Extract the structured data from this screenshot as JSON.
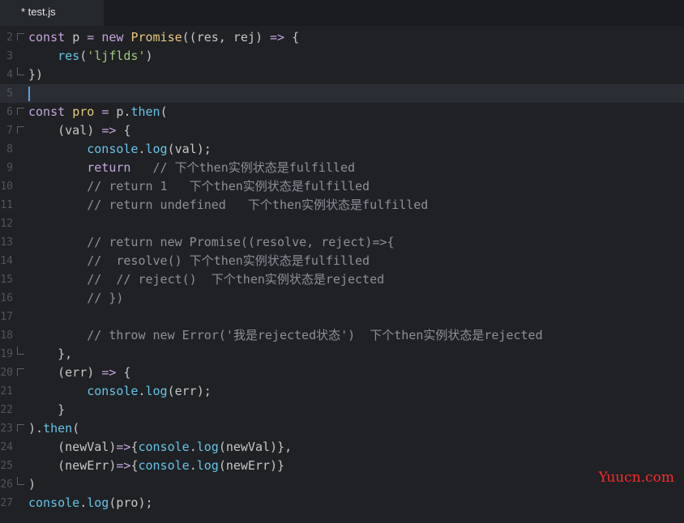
{
  "tab": {
    "label": "* test.js"
  },
  "lines": [
    {
      "num": "2",
      "fold": "start",
      "tokens": [
        {
          "t": "const ",
          "c": "kw"
        },
        {
          "t": "p ",
          "c": "id"
        },
        {
          "t": "= ",
          "c": "op"
        },
        {
          "t": "new ",
          "c": "kw"
        },
        {
          "t": "Promise",
          "c": "cls"
        },
        {
          "t": "((res, rej) ",
          "c": "id"
        },
        {
          "t": "=> ",
          "c": "op"
        },
        {
          "t": "{",
          "c": "id"
        }
      ]
    },
    {
      "num": "3",
      "tokens": [
        {
          "t": "    ",
          "c": "id"
        },
        {
          "t": "res",
          "c": "fn"
        },
        {
          "t": "(",
          "c": "id"
        },
        {
          "t": "'ljflds'",
          "c": "str"
        },
        {
          "t": ")",
          "c": "id"
        }
      ]
    },
    {
      "num": "4",
      "fold": "end",
      "tokens": [
        {
          "t": "})",
          "c": "id"
        }
      ]
    },
    {
      "num": "5",
      "current": true,
      "tokens": []
    },
    {
      "num": "6",
      "fold": "start",
      "tokens": [
        {
          "t": "const ",
          "c": "kw"
        },
        {
          "t": "pro ",
          "c": "cls"
        },
        {
          "t": "= ",
          "c": "op"
        },
        {
          "t": "p.",
          "c": "id"
        },
        {
          "t": "then",
          "c": "fn"
        },
        {
          "t": "(",
          "c": "id"
        }
      ]
    },
    {
      "num": "7",
      "fold": "start",
      "tokens": [
        {
          "t": "    (val) ",
          "c": "id"
        },
        {
          "t": "=> ",
          "c": "op"
        },
        {
          "t": "{",
          "c": "id"
        }
      ]
    },
    {
      "num": "8",
      "tokens": [
        {
          "t": "        ",
          "c": "id"
        },
        {
          "t": "console",
          "c": "fn"
        },
        {
          "t": ".",
          "c": "id"
        },
        {
          "t": "log",
          "c": "fn"
        },
        {
          "t": "(val);",
          "c": "id"
        }
      ]
    },
    {
      "num": "9",
      "tokens": [
        {
          "t": "        ",
          "c": "id"
        },
        {
          "t": "return",
          "c": "kw"
        },
        {
          "t": "   // 下个then实例状态是fulfilled",
          "c": "cm"
        }
      ]
    },
    {
      "num": "10",
      "tokens": [
        {
          "t": "        // return 1   下个then实例状态是fulfilled",
          "c": "cm"
        }
      ]
    },
    {
      "num": "11",
      "tokens": [
        {
          "t": "        // return undefined   下个then实例状态是fulfilled",
          "c": "cm"
        }
      ]
    },
    {
      "num": "12",
      "tokens": []
    },
    {
      "num": "13",
      "tokens": [
        {
          "t": "        // return new Promise((resolve, reject)=>{",
          "c": "cm"
        }
      ]
    },
    {
      "num": "14",
      "tokens": [
        {
          "t": "        //  resolve() 下个then实例状态是fulfilled",
          "c": "cm"
        }
      ]
    },
    {
      "num": "15",
      "tokens": [
        {
          "t": "        //  // reject()  下个then实例状态是rejected",
          "c": "cm"
        }
      ]
    },
    {
      "num": "16",
      "tokens": [
        {
          "t": "        // })",
          "c": "cm"
        }
      ]
    },
    {
      "num": "17",
      "tokens": []
    },
    {
      "num": "18",
      "tokens": [
        {
          "t": "        // throw new Error('我是rejected状态')  下个then实例状态是rejected",
          "c": "cm"
        }
      ]
    },
    {
      "num": "19",
      "fold": "end",
      "tokens": [
        {
          "t": "    },",
          "c": "id"
        }
      ]
    },
    {
      "num": "20",
      "fold": "start",
      "tokens": [
        {
          "t": "    (err) ",
          "c": "id"
        },
        {
          "t": "=> ",
          "c": "op"
        },
        {
          "t": "{",
          "c": "id"
        }
      ]
    },
    {
      "num": "21",
      "tokens": [
        {
          "t": "        ",
          "c": "id"
        },
        {
          "t": "console",
          "c": "fn"
        },
        {
          "t": ".",
          "c": "id"
        },
        {
          "t": "log",
          "c": "fn"
        },
        {
          "t": "(err);",
          "c": "id"
        }
      ]
    },
    {
      "num": "22",
      "tokens": [
        {
          "t": "    }",
          "c": "id"
        }
      ]
    },
    {
      "num": "23",
      "fold": "start",
      "tokens": [
        {
          "t": ").",
          "c": "id"
        },
        {
          "t": "then",
          "c": "fn"
        },
        {
          "t": "(",
          "c": "id"
        }
      ]
    },
    {
      "num": "24",
      "tokens": [
        {
          "t": "    (newVal)",
          "c": "id"
        },
        {
          "t": "=>",
          "c": "op"
        },
        {
          "t": "{",
          "c": "id"
        },
        {
          "t": "console",
          "c": "fn"
        },
        {
          "t": ".",
          "c": "id"
        },
        {
          "t": "log",
          "c": "fn"
        },
        {
          "t": "(newVal)},",
          "c": "id"
        }
      ]
    },
    {
      "num": "25",
      "tokens": [
        {
          "t": "    (newErr)",
          "c": "id"
        },
        {
          "t": "=>",
          "c": "op"
        },
        {
          "t": "{",
          "c": "id"
        },
        {
          "t": "console",
          "c": "fn"
        },
        {
          "t": ".",
          "c": "id"
        },
        {
          "t": "log",
          "c": "fn"
        },
        {
          "t": "(newErr)}",
          "c": "id"
        }
      ]
    },
    {
      "num": "26",
      "fold": "end",
      "tokens": [
        {
          "t": ")",
          "c": "id"
        }
      ]
    },
    {
      "num": "27",
      "tokens": [
        {
          "t": "console",
          "c": "fn"
        },
        {
          "t": ".",
          "c": "id"
        },
        {
          "t": "log",
          "c": "fn"
        },
        {
          "t": "(pro);",
          "c": "id"
        }
      ]
    }
  ],
  "watermark": "Yuucn.com",
  "colors": {
    "background": "#1f2125",
    "keyword": "#c5a5dc",
    "function": "#67c4e8",
    "class": "#e8c87a",
    "string": "#9fc97a",
    "comment": "#8c9098",
    "watermark": "#ff2a2a"
  }
}
